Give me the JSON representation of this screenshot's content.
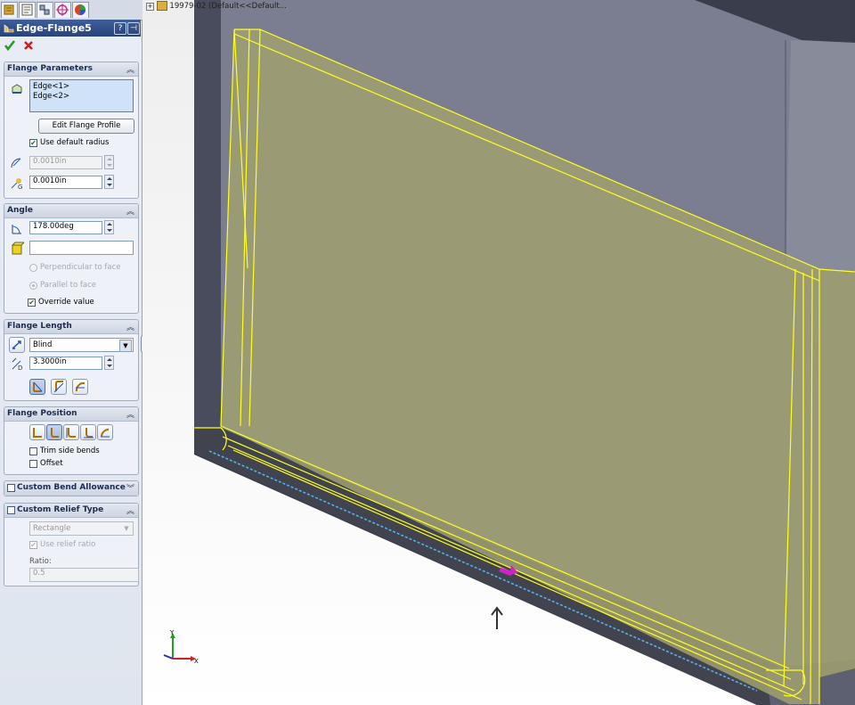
{
  "property_manager": {
    "title": "Edge-Flange5",
    "tab_icons": [
      "feature-manager-icon",
      "property-manager-icon",
      "configuration-manager-icon",
      "dimxpert-icon",
      "display-manager-icon"
    ],
    "help_label": "?",
    "close_label": "×",
    "flange_parameters": {
      "header": "Flange Parameters",
      "edges": [
        "Edge<1>",
        "Edge<2>"
      ],
      "edit_profile_label": "Edit Flange Profile",
      "use_default_radius_label": "Use default radius",
      "use_default_radius_checked": true,
      "bend_radius": "0.0010in",
      "gap_distance": "0.0010in"
    },
    "angle": {
      "header": "Angle",
      "angle_value": "178.00deg",
      "reference_face": "",
      "perpendicular_label": "Perpendicular to face",
      "parallel_label": "Parallel to face",
      "override_label": "Override value",
      "override_checked": true
    },
    "flange_length": {
      "header": "Flange Length",
      "end_condition": "Blind",
      "length_value": "3.3000in"
    },
    "flange_position": {
      "header": "Flange Position",
      "trim_side_bends_label": "Trim side bends",
      "offset_label": "Offset"
    },
    "custom_bend_allowance": {
      "header": "Custom Bend Allowance"
    },
    "custom_relief_type": {
      "header": "Custom Relief Type",
      "relief_type": "Rectangle",
      "use_relief_ratio_label": "Use relief ratio",
      "ratio_label": "Ratio:",
      "ratio_value": "0.5"
    }
  },
  "viewport": {
    "tree_label": "19979-02  (Default<<Default..."
  },
  "colors": {
    "accent": "#27437a",
    "flange_fill": "#a0a070",
    "edge_highlight": "#ffff00",
    "part_face": "#7a7e90"
  }
}
